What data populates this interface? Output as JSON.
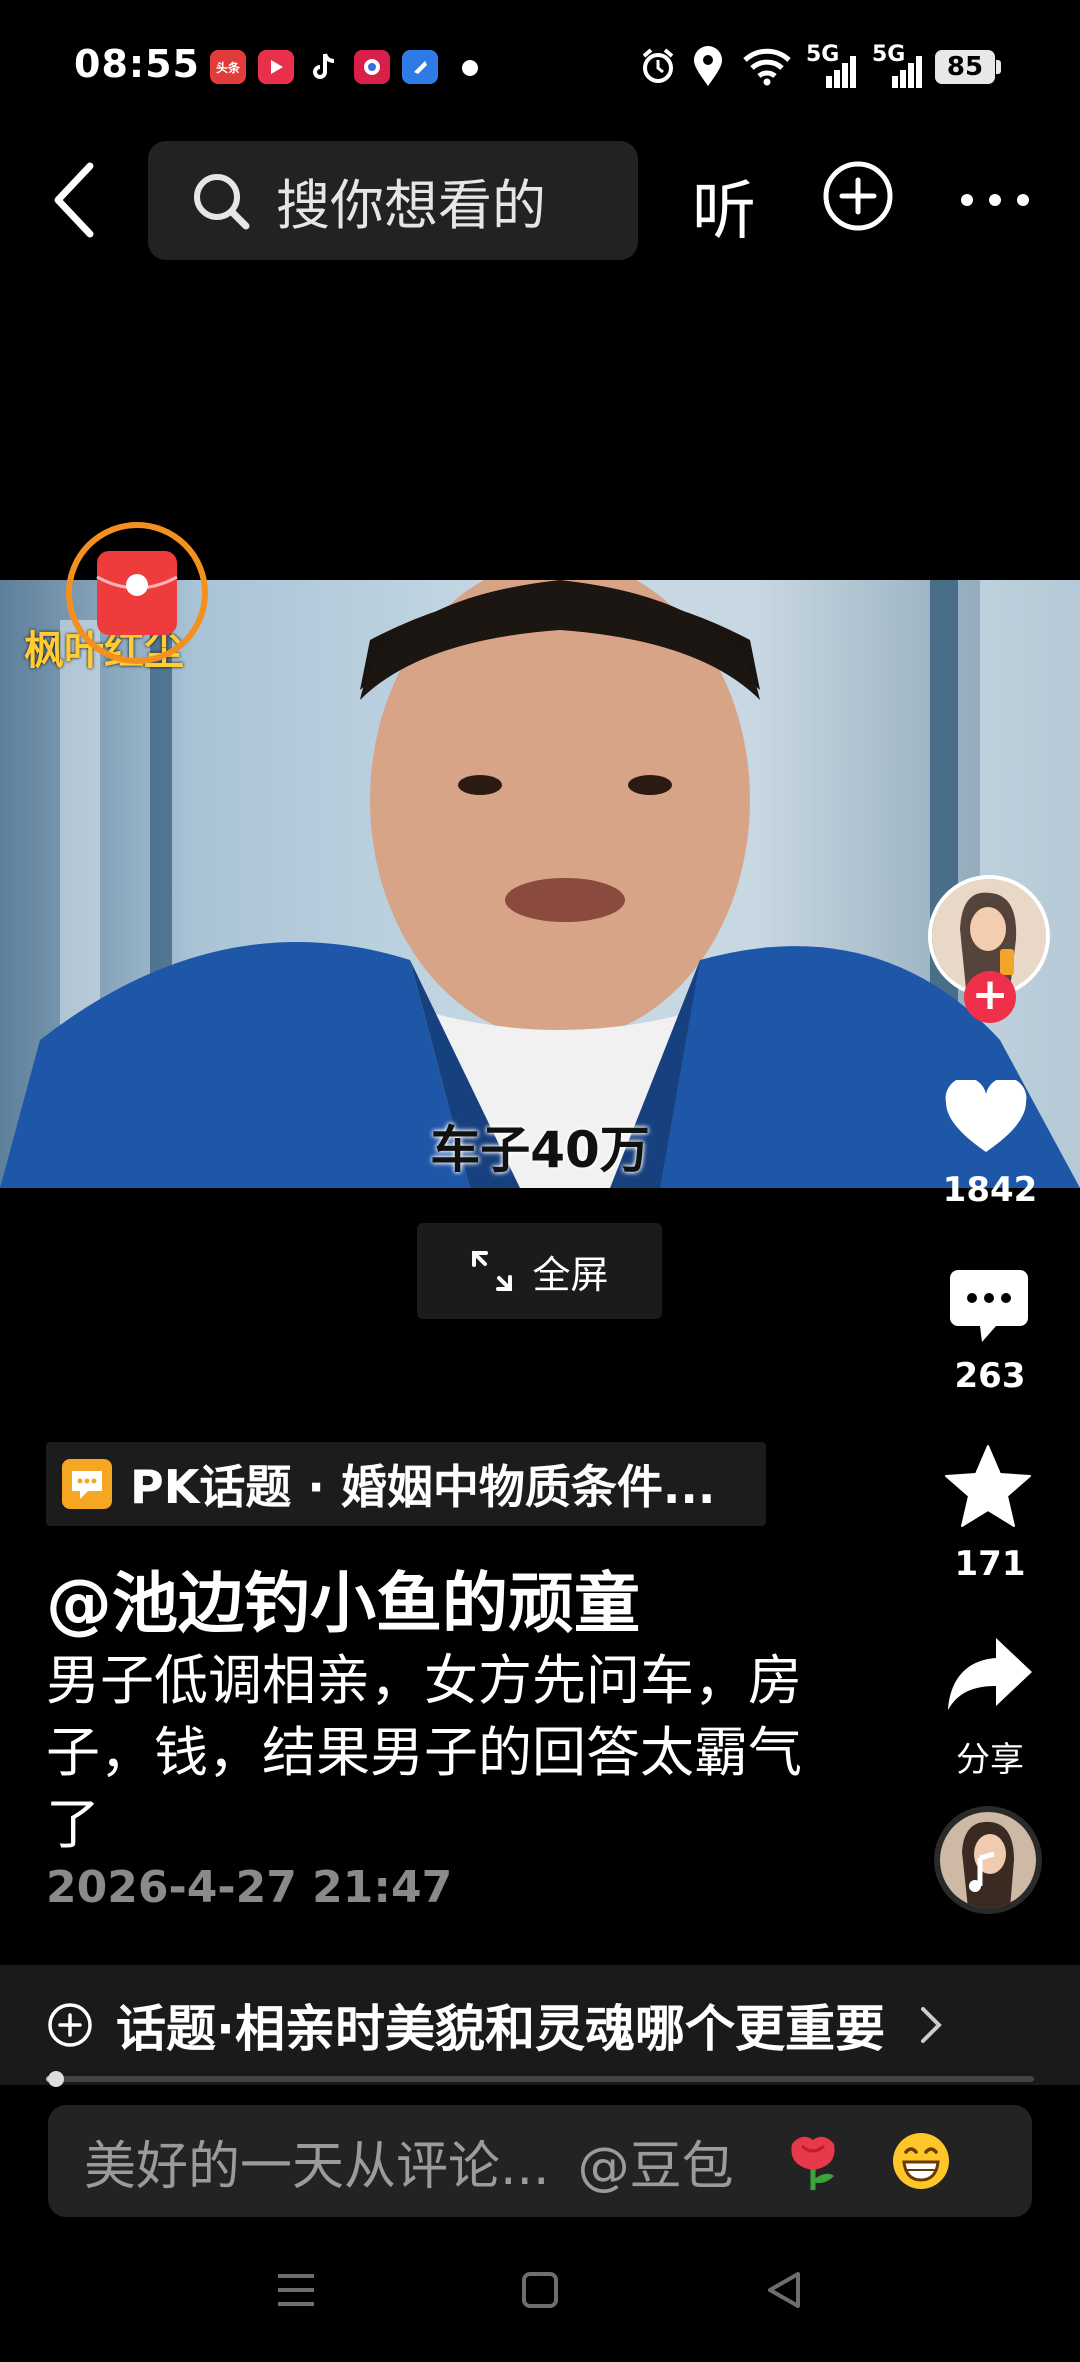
{
  "status_bar": {
    "time": "08:55",
    "battery": "85",
    "network_1": "5G",
    "network_2": "5G"
  },
  "top_bar": {
    "search_placeholder": "搜你想看的",
    "listen_label": "听"
  },
  "video": {
    "watermark": "枫叶红尘",
    "subtitle": "车子40万"
  },
  "fullscreen": {
    "label": "全屏"
  },
  "actions": {
    "like_count": "1842",
    "comment_count": "263",
    "favorite_count": "171",
    "share_label": "分享"
  },
  "post": {
    "pk_topic": "PK话题 · 婚姻中物质条件...",
    "author": "@池边钓小鱼的顽童",
    "description": "男子低调相亲，女方先问车，房子，钱，结果男子的回答太霸气了",
    "time": "2026-4-27 21:47"
  },
  "topic_bar": {
    "label": "话题·相亲时美貌和灵魂哪个更重要"
  },
  "progress": {
    "value": 0.01
  },
  "comment_bar": {
    "placeholder": "美好的一天从评论...",
    "mention": "@豆包"
  },
  "colors": {
    "accent_red": "#f0304a",
    "red_packet_ring": "#f3901f",
    "tag_icon_orange": "#f5a623"
  }
}
